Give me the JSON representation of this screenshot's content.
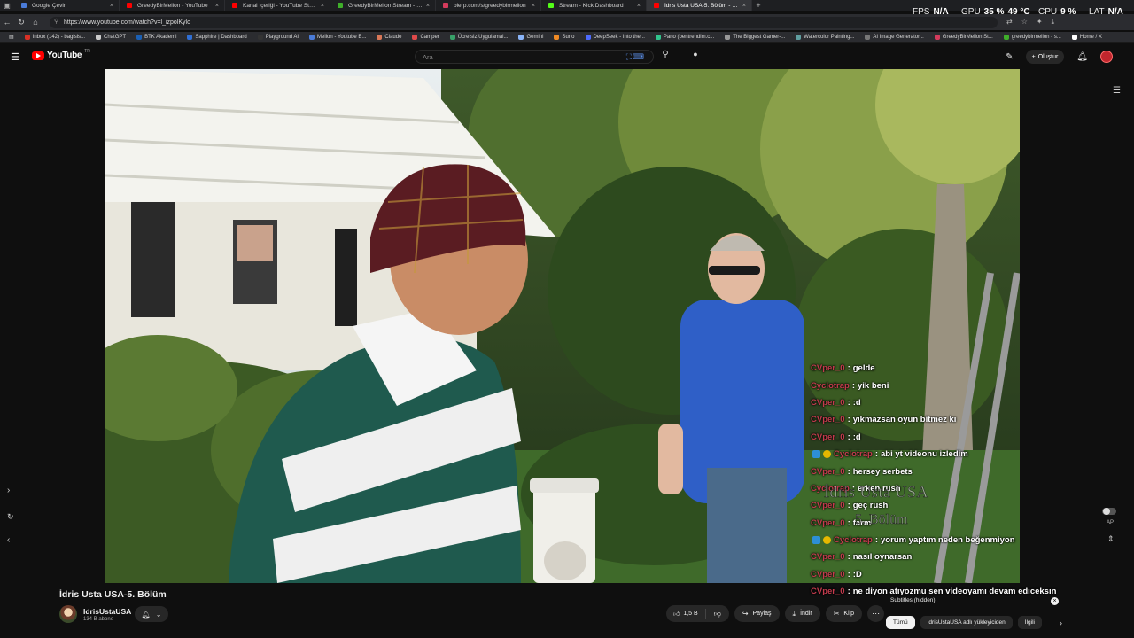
{
  "browser": {
    "tabs": [
      {
        "label": "Google Çeviri",
        "color": "#4a7bd8",
        "active": false
      },
      {
        "label": "GreedyBirMellon - YouTube",
        "color": "#ff0000",
        "active": false
      },
      {
        "label": "Kanal İçeriği - YouTube Studio",
        "color": "#ff0000",
        "active": false
      },
      {
        "label": "GreedyBirMellon Stream - Watch...",
        "color": "#3fae2a",
        "active": false
      },
      {
        "label": "blerp.com/s/greedybirmellon",
        "color": "#d43b5c",
        "active": false
      },
      {
        "label": "Stream - Kick Dashboard",
        "color": "#53fc18",
        "active": false
      },
      {
        "label": "İdris Usta USA-5. Bölüm - Yo...",
        "color": "#ff0000",
        "active": true
      }
    ],
    "url": "https://www.youtube.com/watch?v=l_izpolKylc",
    "bookmarks": [
      {
        "label": "Inbox (142) - bagisis...",
        "color": "#d93025"
      },
      {
        "label": "ChatGPT",
        "color": "#cccccc"
      },
      {
        "label": "BTK Akademi",
        "color": "#1a5fb4"
      },
      {
        "label": "Sapphire | Dashboard",
        "color": "#2f6fd6"
      },
      {
        "label": "Playground AI",
        "color": "#333333"
      },
      {
        "label": "Mellon - Youtube B...",
        "color": "#4a7bd8"
      },
      {
        "label": "Claude",
        "color": "#d97757"
      },
      {
        "label": "Camper",
        "color": "#e04a4a"
      },
      {
        "label": "Ücretsiz Uygulamal...",
        "color": "#38a169"
      },
      {
        "label": "Gemini",
        "color": "#8ab4f8"
      },
      {
        "label": "Suno",
        "color": "#f08a24"
      },
      {
        "label": "DeepSeek - Into the...",
        "color": "#4d6bfe"
      },
      {
        "label": "Pano (bentrendim.c...",
        "color": "#31c48d"
      },
      {
        "label": "The Biggest Gamer-...",
        "color": "#999999"
      },
      {
        "label": "Watercolor Painting...",
        "color": "#5f9ea0"
      },
      {
        "label": "AI Image Generator...",
        "color": "#777777"
      },
      {
        "label": "GreedyBirMellon St...",
        "color": "#d43b5c"
      },
      {
        "label": "greedybirmellon - s...",
        "color": "#3fae2a"
      },
      {
        "label": "Home / X",
        "color": "#ffffff"
      }
    ]
  },
  "hud": {
    "fps_label": "FPS",
    "fps_value": "N/A",
    "gpu_label": "GPU",
    "gpu_value": "35 %",
    "gpu_temp": "49 °C",
    "cpu_label": "CPU",
    "cpu_value": "9 %",
    "lat_label": "LAT",
    "lat_value": "N/A"
  },
  "youtube": {
    "logo_text": "YouTube",
    "logo_region": "TR",
    "search_placeholder": "Ara",
    "create_label": "Oluştur"
  },
  "chat": [
    {
      "user": "CVper_0",
      "text": "gelde",
      "badges": false
    },
    {
      "user": "Cyclotrap",
      "text": "yik beni",
      "badges": false
    },
    {
      "user": "CVper_0",
      "text": ":d",
      "badges": false
    },
    {
      "user": "CVper_0",
      "text": "yıkmazsan oyun bitmez kı",
      "badges": false
    },
    {
      "user": "CVper_0",
      "text": ":d",
      "badges": false
    },
    {
      "user": "Cyclotrap",
      "text": "abi yt videonu izledim",
      "badges": true
    },
    {
      "user": "CVper_0",
      "text": "hersey serbets",
      "badges": false
    },
    {
      "user": "Cyclotrap",
      "text": "erken rush",
      "badges": false
    },
    {
      "user": "CVper_0",
      "text": "geç rush",
      "badges": false
    },
    {
      "user": "CVper_0",
      "text": "farm",
      "badges": false
    },
    {
      "user": "Cyclotrap",
      "text": "yorum yaptım neden beğenmiyon",
      "badges": true
    },
    {
      "user": "CVper_0",
      "text": "nasıl oynarsan",
      "badges": false
    },
    {
      "user": "CVper_0",
      "text": ":D",
      "badges": false
    },
    {
      "user": "CVper_0",
      "text": "ne diyon atıyozmu sen videoyamı devam edıceksın",
      "badges": false
    }
  ],
  "watermark": {
    "line1": "İdris Usta USA",
    "line2": "5. Bölüm"
  },
  "video": {
    "title": "İdris Usta USA-5. Bölüm",
    "channel": "IdrisUstaUSA",
    "subscribers": "134 B abone",
    "likes": "1,5 B",
    "share_label": "Paylaş",
    "download_label": "İndir",
    "clip_label": "Klip"
  },
  "side": {
    "subtitles_hidden": "Subtitles (hidden)",
    "chips": [
      {
        "label": "Tümü",
        "active": true
      },
      {
        "label": "IdrisUstaUSA adlı yükleyiciden",
        "active": false
      },
      {
        "label": "İlgili",
        "active": false
      }
    ],
    "autoplay_label": "AP"
  }
}
